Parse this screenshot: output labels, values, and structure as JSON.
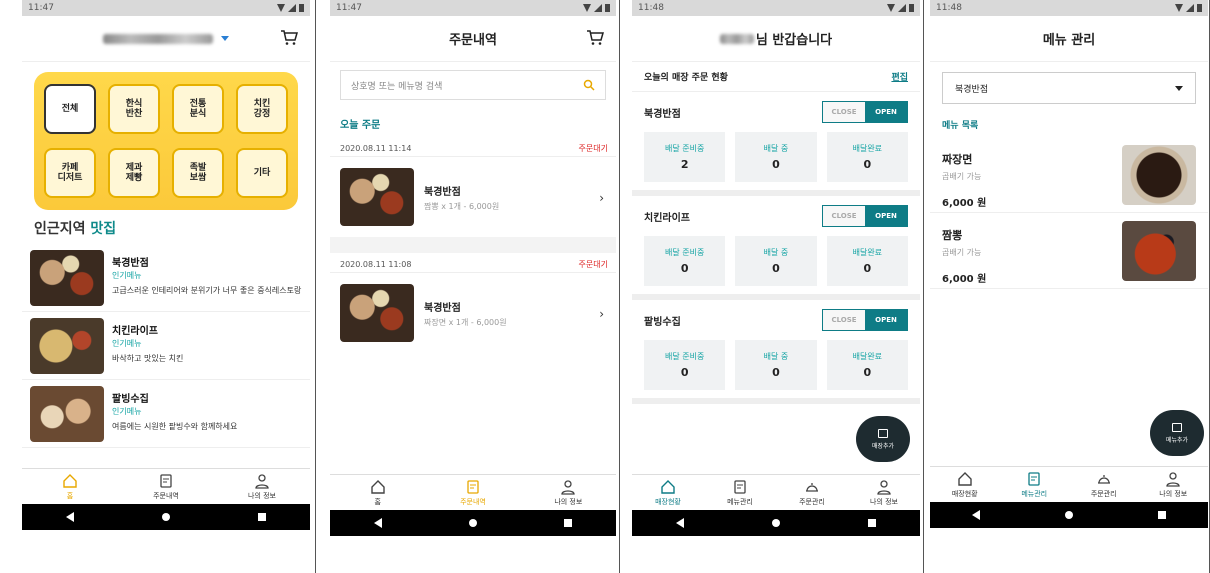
{
  "panel1": {
    "status": {
      "time": "11:47"
    },
    "cats": [
      {
        "label": "전체",
        "selected": true
      },
      {
        "label": "한식\n반찬"
      },
      {
        "label": "전통\n분식"
      },
      {
        "label": "치킨\n강정"
      },
      {
        "label": "카페\n디저트"
      },
      {
        "label": "제과\n제빵"
      },
      {
        "label": "족발\n보쌈"
      },
      {
        "label": "기타"
      }
    ],
    "near_prefix": "인근지역 ",
    "near_highlight": "맛집",
    "stores": [
      {
        "name": "북경반점",
        "pop": "인기메뉴",
        "desc": "고급스러운 인테리어와 분위기가 너무 좋은 중식레스토랑"
      },
      {
        "name": "치킨라이프",
        "pop": "인기메뉴",
        "desc": "바삭하고 맛있는 치킨"
      },
      {
        "name": "팔빙수집",
        "pop": "인기메뉴",
        "desc": "여름에는 시원한 팥빙수와 함께하세요"
      }
    ],
    "nav": [
      "홈",
      "주문내역",
      "나의 정보"
    ]
  },
  "panel2": {
    "status": {
      "time": "11:47"
    },
    "title": "주문내역",
    "search_placeholder": "상호명 또는 메뉴명 검색",
    "today": "오늘 주문",
    "orders": [
      {
        "time": "2020.08.11 11:14",
        "status": "주문대기",
        "store": "북경반점",
        "detail": "짬뽕 x 1개 - 6,000원"
      },
      {
        "time": "2020.08.11 11:08",
        "status": "주문대기",
        "store": "북경반점",
        "detail": "짜장면 x 1개 - 6,000원"
      }
    ],
    "nav": [
      "홈",
      "주문내역",
      "나의 정보"
    ]
  },
  "panel3": {
    "status": {
      "time": "11:48"
    },
    "title_suffix": "님 반갑습니다",
    "section": "오늘의 매장 주문 현황",
    "edit": "편집",
    "toggle_close": "CLOSE",
    "toggle_open": "OPEN",
    "stores": [
      {
        "name": "북경반점",
        "stats": [
          {
            "label": "배달 준비중",
            "value": "2"
          },
          {
            "label": "배달 중",
            "value": "0"
          },
          {
            "label": "배달완료",
            "value": "0"
          }
        ]
      },
      {
        "name": "치킨라이프",
        "stats": [
          {
            "label": "배달 준비중",
            "value": "0"
          },
          {
            "label": "배달 중",
            "value": "0"
          },
          {
            "label": "배달완료",
            "value": "0"
          }
        ]
      },
      {
        "name": "팥빙수집",
        "stats": [
          {
            "label": "배달 준비중",
            "value": "0"
          },
          {
            "label": "배달 중",
            "value": "0"
          },
          {
            "label": "배달완료",
            "value": "0"
          }
        ]
      }
    ],
    "fab": "매장추가",
    "nav": [
      "매장현황",
      "메뉴관리",
      "주문관리",
      "나의 정보"
    ]
  },
  "panel4": {
    "status": {
      "time": "11:48"
    },
    "title": "메뉴 관리",
    "select": "북경반점",
    "menu_label": "메뉴 목록",
    "menus": [
      {
        "name": "짜장면",
        "sub": "곱배기 가능",
        "price": "6,000 원"
      },
      {
        "name": "짬뽕",
        "sub": "곱배기 가능",
        "price": "6,000 원"
      }
    ],
    "fab": "메뉴추가",
    "nav": [
      "매장현황",
      "메뉴관리",
      "주문관리",
      "나의 정보"
    ]
  },
  "colors": {
    "accent": "#0e7c86",
    "yellow": "#ffd84a",
    "active_yellow": "#e8a800",
    "red": "#d22222"
  }
}
